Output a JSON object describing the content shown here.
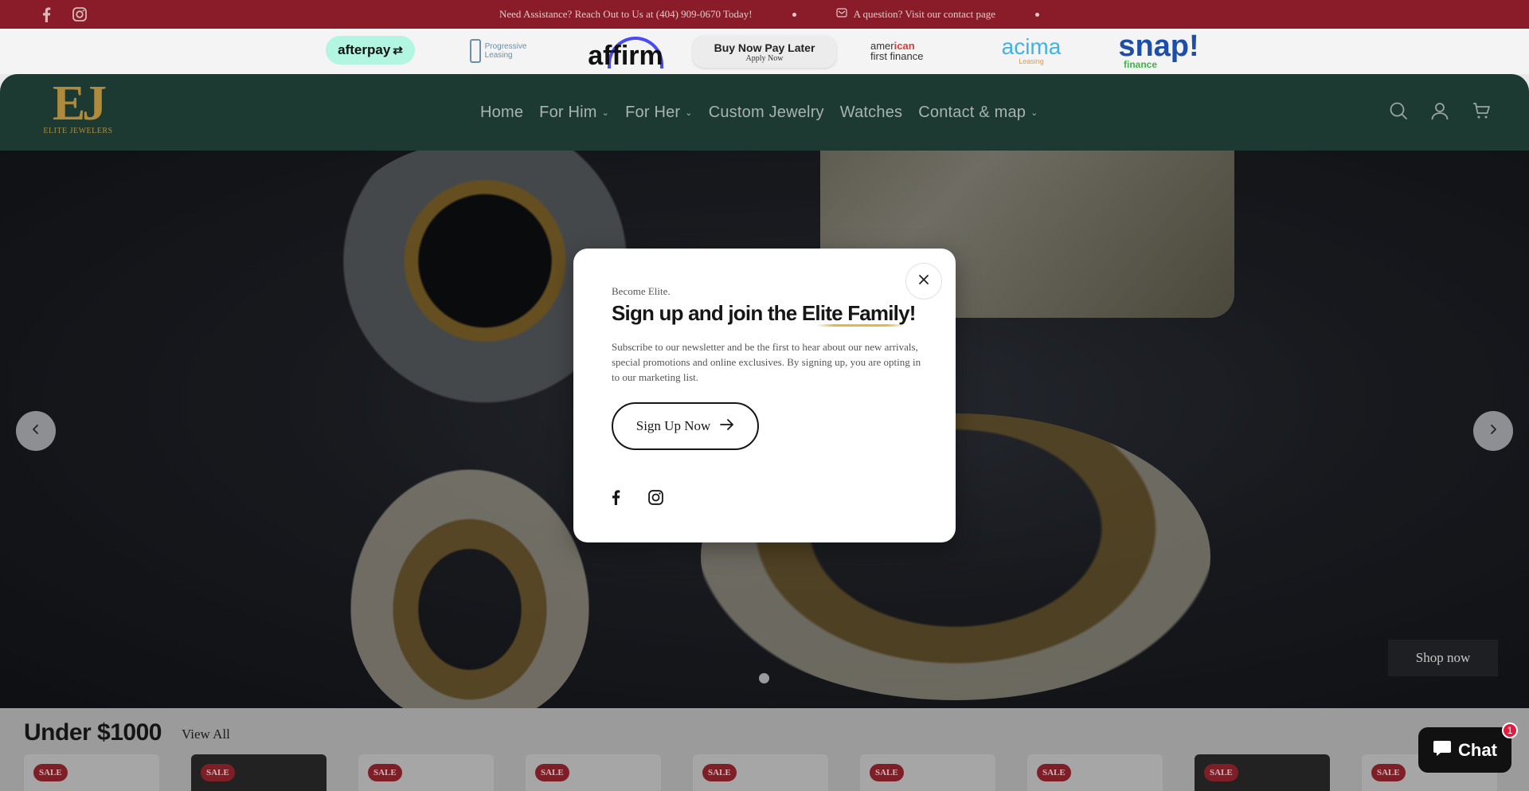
{
  "announcement": {
    "phone_msg": "Need Assistance? Reach Out to Us at (404) 909-0670 Today!",
    "contact_msg": "A question? Visit our contact page"
  },
  "financing": {
    "afterpay": "afterpay",
    "progressive_line1": "Progressive",
    "progressive_line2": "Leasing",
    "affirm": "affirm",
    "bnpl_title": "Buy Now Pay Later",
    "bnpl_sub": "Apply Now",
    "american_line1_a": "amer",
    "american_line1_b": "ican",
    "american_line2": "first finance",
    "acima": "acima",
    "acima_sub": "Leasing",
    "snap": "snap!",
    "snap_sub": "finance"
  },
  "header": {
    "logo_mark": "EJ",
    "logo_name": "ELITE JEWELERS",
    "nav": [
      "Home",
      "For Him",
      "For Her",
      "Custom Jewelry",
      "Watches",
      "Contact & map"
    ]
  },
  "hero": {
    "cta": "Shop now"
  },
  "section": {
    "title": "Under $1000",
    "view_all": "View All",
    "sale_badge": "SALE"
  },
  "chat": {
    "label": "Chat",
    "badge": "1"
  },
  "modal": {
    "kicker": "Become Elite.",
    "headline_a": "Sign up and join the ",
    "headline_b": "Elite Family",
    "headline_c": "!",
    "body": "Subscribe to our newsletter and be the first to hear about our new arrivals, special promotions and online exclusives. By signing up, you are opting in to our marketing list.",
    "cta": "Sign Up Now"
  },
  "colors": {
    "announcement_bg": "#8a1c2a",
    "header_bg": "#1c3a31",
    "gold": "#b08a3c",
    "sale_badge": "#7e1f27"
  },
  "icons": [
    "facebook-icon",
    "instagram-icon",
    "mail-icon",
    "search-icon",
    "account-icon",
    "cart-icon",
    "chevron-left-icon",
    "chevron-right-icon",
    "close-icon",
    "arrow-right-icon",
    "chat-icon"
  ]
}
